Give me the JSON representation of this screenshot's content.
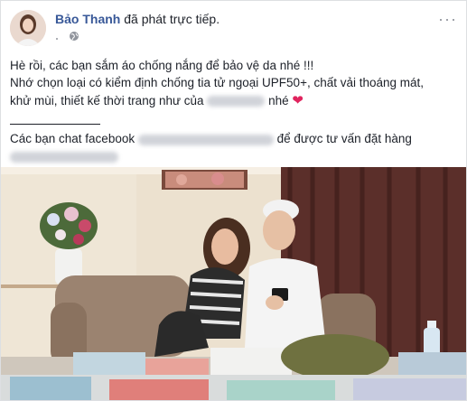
{
  "post": {
    "author": "Bảo Thanh",
    "action": "đã phát trực tiếp.",
    "menu_label": "···",
    "icons": {
      "avatar": "profile-avatar",
      "privacy": "globe-icon",
      "menu": "more-options-icon",
      "heart": "red-heart-emoji"
    },
    "lines": [
      "Hè rồi, các bạn sắm áo chống nắng để bảo vệ da nhé !!!",
      "Nhớ chọn loại có kiểm định chống tia tử ngoại UPF50+, chất vải thoáng mát,",
      "khử mùi, thiết kế thời trang như của"
    ],
    "line3_suffix": "nhé",
    "heart": "❤",
    "chat_prefix": "Các bạn chat facebook",
    "chat_suffix": "để được tư vấn đặt hàng"
  },
  "colors": {
    "name": "#385898",
    "text": "#1d2129",
    "muted": "#90949c",
    "heart": "#e0245e"
  }
}
